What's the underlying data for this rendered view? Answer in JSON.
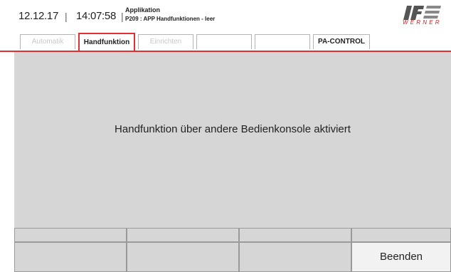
{
  "header": {
    "date": "12.12.17",
    "time": "14:07:58",
    "separator": "|",
    "app_label": "Applikation",
    "app_subtitle": "P209 : APP Handfunktionen - leer",
    "logo_text": "WERNER",
    "logo_color": "#d42020"
  },
  "tabs": [
    {
      "label": "Automatik",
      "state": "disabled"
    },
    {
      "label": "Handfunktion",
      "state": "active"
    },
    {
      "label": "Einrichten",
      "state": "disabled"
    },
    {
      "label": "",
      "state": "empty"
    },
    {
      "label": "",
      "state": "empty"
    },
    {
      "label": "PA-CONTROL",
      "state": "normal"
    }
  ],
  "main": {
    "message": "Handfunktion über andere Bedienkonsole aktiviert"
  },
  "function_bar": {
    "buttons": [
      "",
      "",
      "",
      "Beenden"
    ]
  },
  "colors": {
    "accent": "#e23030",
    "panel_background": "#d6d6d6"
  }
}
